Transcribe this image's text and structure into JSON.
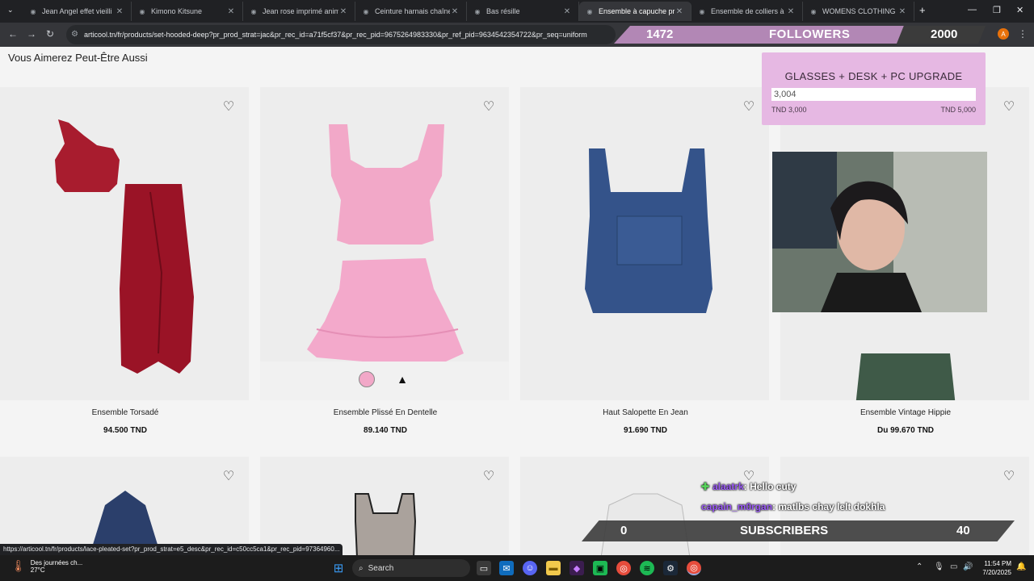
{
  "tabs": [
    {
      "title": "Jean Angel effet vieilli"
    },
    {
      "title": "Kimono Kitsune"
    },
    {
      "title": "Jean rose imprimé anime"
    },
    {
      "title": "Ceinture harnais chaîne c"
    },
    {
      "title": "Bas résille"
    },
    {
      "title": "Ensemble à capuche prof"
    },
    {
      "title": "Ensemble de colliers à ch"
    },
    {
      "title": "WOMENS CLOTHING | Ki"
    }
  ],
  "address": {
    "url": "articool.tn/fr/products/set-hooded-deep?pr_prod_strat=jac&pr_rec_id=a71f5cf37&pr_rec_pid=9675264983330&pr_ref_pid=9634542354722&pr_seq=uniform"
  },
  "overlay": {
    "followers_count": "1472",
    "followers_label": "FOLLOWERS",
    "followers_goal": "2000",
    "goal_title": "GLASSES + DESK + PC UPGRADE",
    "goal_value": "3,004",
    "goal_min": "TND 3,000",
    "goal_max": "TND 5,000",
    "subs_count": "0",
    "subs_label": "SUBSCRIBERS",
    "subs_goal": "40"
  },
  "chat": [
    {
      "user": "alaatrk",
      "message": ": Hello cuty"
    },
    {
      "user": "capain_m0rgan",
      "message": ": matlbs chay lelt dokhla"
    }
  ],
  "page": {
    "section_title": "Vous Aimerez Peut-Être Aussi",
    "products": [
      {
        "name": "Ensemble Torsadé",
        "price": "94.500 TND"
      },
      {
        "name": "Ensemble Plissé En Dentelle",
        "price": "89.140 TND"
      },
      {
        "name": "Haut Salopette En Jean",
        "price": "91.690 TND"
      },
      {
        "name": "Ensemble Vintage Hippie",
        "price_prefix": "Du",
        "price": "99.670 TND"
      }
    ]
  },
  "status_url": "https://articool.tn/fr/products/lace-pleated-set?pr_prod_strat=e5_desc&pr_rec_id=c50cc5ca1&pr_rec_pid=97364960...",
  "taskbar": {
    "weather_text": "Des journées ch...",
    "temperature": "27°C",
    "search_label": "Search",
    "time": "11:54 PM",
    "date": "7/20/2025"
  },
  "colors": {
    "followers_bar": "#b287b5",
    "goal_box": "#e6b8e3",
    "chat_user": "#9b59f7"
  }
}
